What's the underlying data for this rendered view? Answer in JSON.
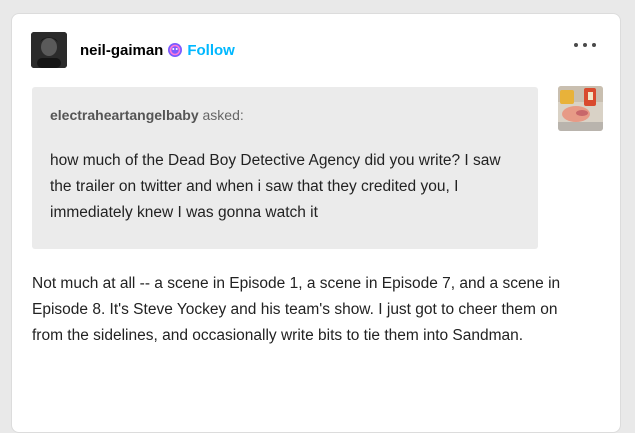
{
  "post": {
    "author": {
      "username": "neil-gaiman",
      "badge_icon": "patio-badge-icon",
      "follow_label": "Follow",
      "follow_color": "#00b8ff"
    },
    "more_menu_icon": "ellipsis-icon",
    "ask": {
      "asker": "electraheartangelbaby",
      "asked_label": "asked:",
      "question": "how much of the Dead Boy Detective Agency did you write? I saw the trailer on twitter and when i saw that they credited you, I immediately knew I was gonna watch it"
    },
    "answer": {
      "text": "Not much at all --  a scene in Episode 1, a scene in Episode 7, and a scene in Episode 8.  It's Steve Yockey and his team's show. I just got to cheer them on from the sidelines, and occasionally write bits to tie them into Sandman."
    }
  }
}
